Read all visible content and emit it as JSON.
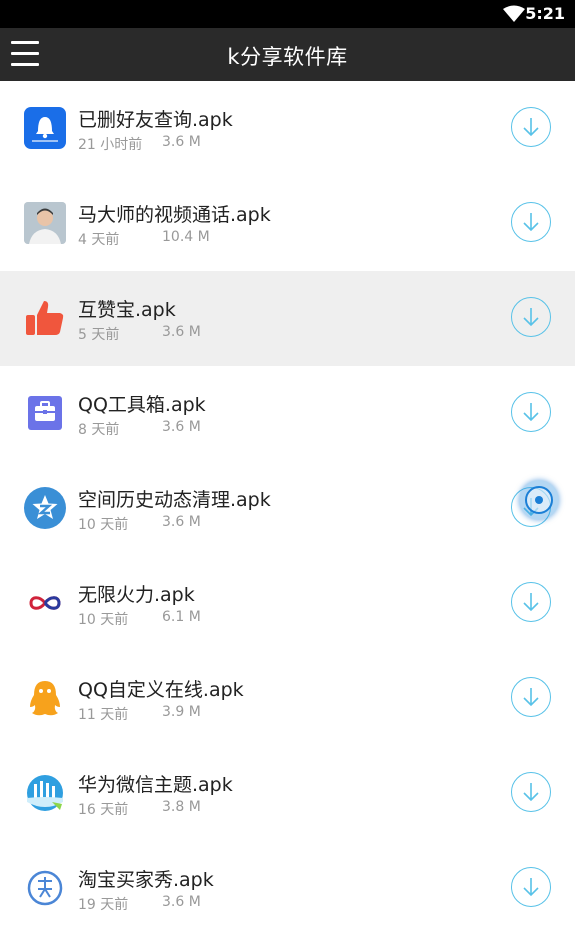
{
  "status_bar": {
    "time": "5:21"
  },
  "app_bar": {
    "title": "k分享软件库"
  },
  "files": [
    {
      "name": "已删好友查询.apk",
      "time": "21 小时前",
      "size": "3.6 M",
      "icon": "qq-bell-icon",
      "icon_color": "#1a6ee8"
    },
    {
      "name": "马大师的视频通话.apk",
      "time": "4 天前",
      "size": "10.4 M",
      "icon": "portrait-icon",
      "icon_color": "#c9c9c9"
    },
    {
      "name": "互赞宝.apk",
      "time": "5 天前",
      "size": "3.6 M",
      "icon": "thumbs-up-icon",
      "icon_color": "#f0563d"
    },
    {
      "name": "QQ工具箱.apk",
      "time": "8 天前",
      "size": "3.6 M",
      "icon": "toolbox-icon",
      "icon_color": "#6b73e8"
    },
    {
      "name": "空间历史动态清理.apk",
      "time": "10 天前",
      "size": "3.6 M",
      "icon": "qzone-icon",
      "icon_color": "#3a8fd6"
    },
    {
      "name": "无限火力.apk",
      "time": "10 天前",
      "size": "6.1 M",
      "icon": "infinity-icon",
      "icon_color": "#d0233b"
    },
    {
      "name": "QQ自定义在线.apk",
      "time": "11 天前",
      "size": "3.9 M",
      "icon": "qq-penguin-icon",
      "icon_color": "#f7a21c"
    },
    {
      "name": "华为微信主题.apk",
      "time": "16 天前",
      "size": "3.8 M",
      "icon": "theme-icon",
      "icon_color": "#2f9fe0"
    },
    {
      "name": "淘宝买家秀.apk",
      "time": "19 天前",
      "size": "3.6 M",
      "icon": "xiu-icon",
      "icon_color": "#4b86d6"
    }
  ],
  "accent_color": "#58c2e8"
}
